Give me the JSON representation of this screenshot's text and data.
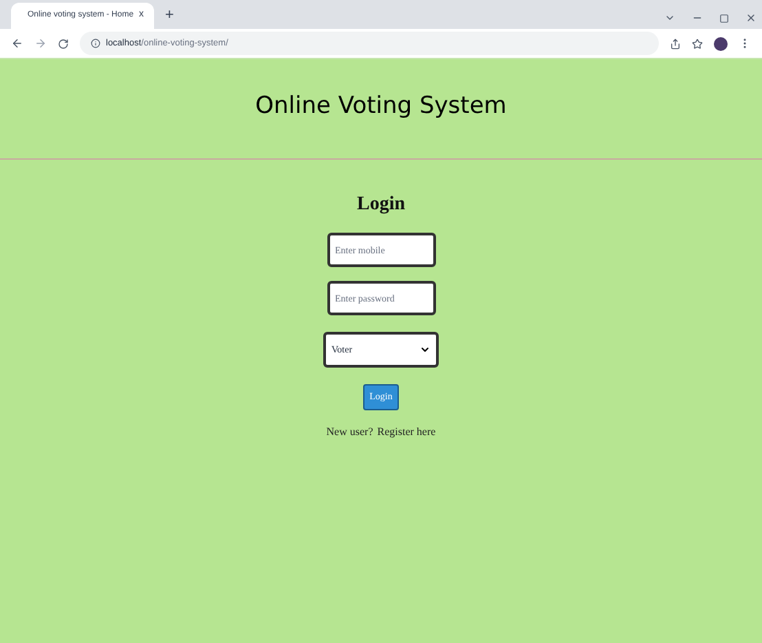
{
  "browser": {
    "tab_title": "Online voting system - Home",
    "tab_close": "x",
    "new_tab": "+",
    "url_host": "localhost",
    "url_path": "/online-voting-system/"
  },
  "header": {
    "title": "Online Voting System"
  },
  "login": {
    "heading": "Login",
    "mobile": {
      "placeholder": "Enter mobile"
    },
    "password": {
      "placeholder": "Enter password"
    },
    "role": {
      "value": "Voter"
    },
    "button": "Login",
    "prompt": "New user?",
    "register_link": "Register here"
  }
}
